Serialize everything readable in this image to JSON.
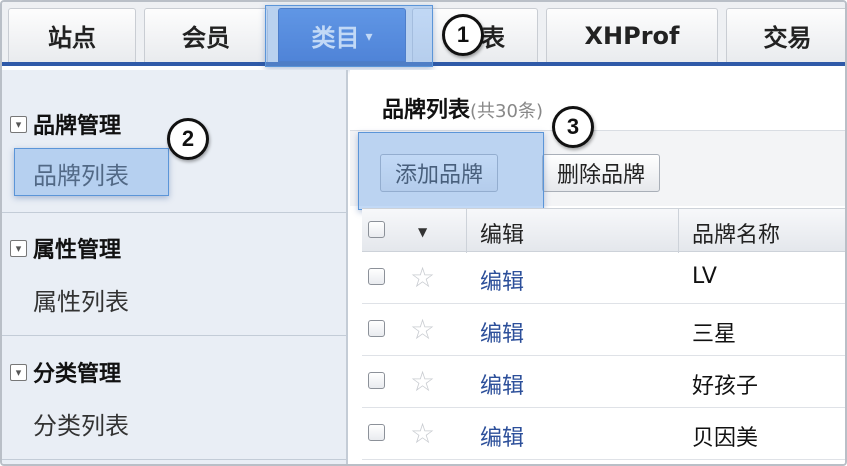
{
  "tabs": [
    {
      "label": "站点"
    },
    {
      "label": "会员"
    },
    {
      "label": "类目",
      "caret": "▾"
    },
    {
      "label": "表"
    },
    {
      "label": "XHProf"
    },
    {
      "label": "交易"
    }
  ],
  "callouts": [
    "1",
    "2",
    "3"
  ],
  "sidebar": {
    "groups": [
      {
        "title": "品牌管理",
        "item": "品牌列表"
      },
      {
        "title": "属性管理",
        "item": "属性列表"
      },
      {
        "title": "分类管理",
        "item": "分类列表"
      }
    ]
  },
  "main": {
    "title": "品牌列表",
    "count": "(共30条)",
    "buttons": {
      "add": "添加品牌",
      "delete": "删除品牌"
    },
    "columns": [
      "编辑",
      "品牌名称"
    ],
    "rows": [
      {
        "edit": "编辑",
        "name": "LV"
      },
      {
        "edit": "编辑",
        "name": "三星"
      },
      {
        "edit": "编辑",
        "name": "好孩子"
      },
      {
        "edit": "编辑",
        "name": "贝因美"
      }
    ]
  },
  "colors": {
    "accent": "#2f64c8",
    "link": "#2c4f9a",
    "highlight": "#78aaeb"
  }
}
